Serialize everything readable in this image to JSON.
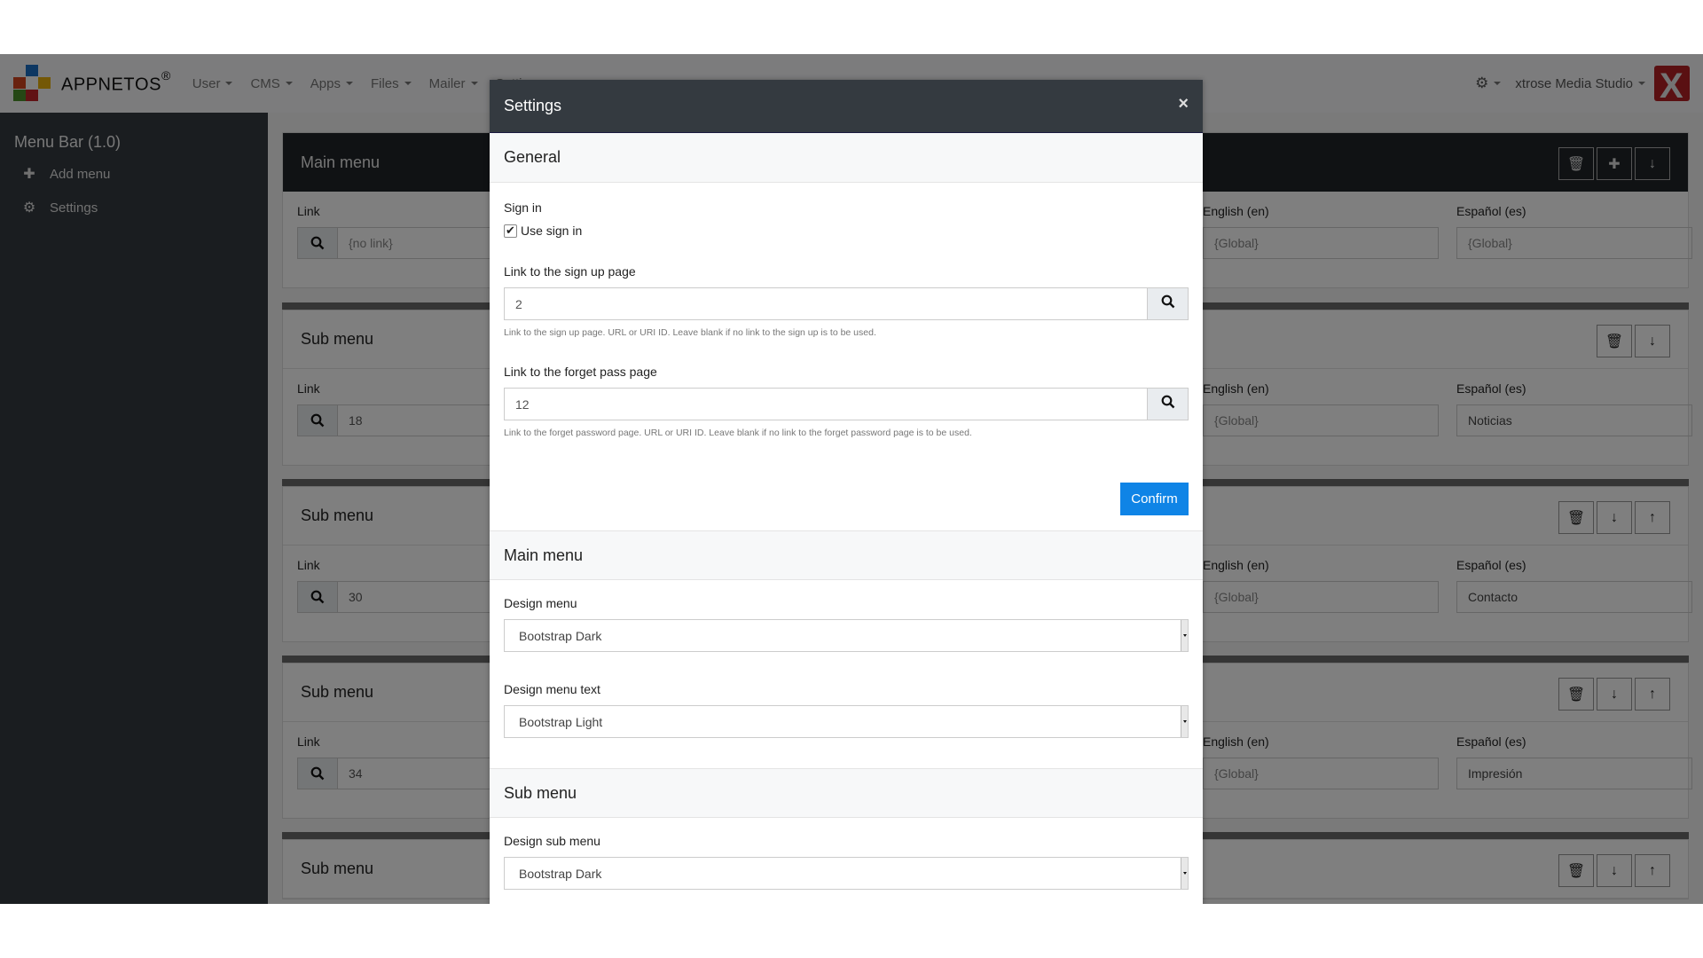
{
  "navbar": {
    "brand": "APPNET",
    "brand_suffix": "OS",
    "brand_mark": "®",
    "menu": [
      {
        "label": "User"
      },
      {
        "label": "CMS"
      },
      {
        "label": "Apps"
      },
      {
        "label": "Files"
      },
      {
        "label": "Mailer"
      },
      {
        "label": "Settings"
      }
    ],
    "gear_icon": "gear-icon",
    "user_name": "xtrose Media Studio",
    "user_badge": "X"
  },
  "sidebar": {
    "title": "Menu Bar (1.0)",
    "items": [
      {
        "label": "Add menu",
        "icon": "+"
      },
      {
        "label": "Settings",
        "icon": "⚙"
      }
    ]
  },
  "background": {
    "link_label": "Link",
    "lang_en": "English (en)",
    "lang_es": "Español (es)",
    "panels": [
      {
        "title": "Main menu",
        "link": "{no link}",
        "en": "{Global}",
        "es": "{Global}"
      },
      {
        "title": "Sub menu",
        "link": "18",
        "en": "{Global}",
        "es": "Noticias"
      },
      {
        "title": "Sub menu",
        "link": "30",
        "en": "{Global}",
        "es": "Contacto"
      },
      {
        "title": "Sub menu",
        "link": "34",
        "en": "{Global}",
        "es": "Impresión"
      },
      {
        "title": "Sub menu"
      }
    ]
  },
  "modal": {
    "title": "Settings",
    "close": "×",
    "general": {
      "heading": "General",
      "sign_in_label": "Sign in",
      "use_sign_in_label": "Use sign in",
      "use_sign_in_checked": true,
      "signup_label": "Link to the sign up page",
      "signup_value": "2",
      "signup_help": "Link to the sign up page. URL or URI ID. Leave blank if no link to the sign up is to be used.",
      "forget_label": "Link to the forget pass page",
      "forget_value": "12",
      "forget_help": "Link to the forget password page. URL or URI ID. Leave blank if no link to the forget password page is to be used.",
      "confirm": "Confirm"
    },
    "main_menu": {
      "heading": "Main menu",
      "design_label": "Design menu",
      "design_value": "Bootstrap Dark",
      "design_text_label": "Design menu text",
      "design_text_value": "Bootstrap Light"
    },
    "sub_menu": {
      "heading": "Sub menu",
      "design_label": "Design sub menu",
      "design_value": "Bootstrap Dark"
    }
  },
  "colors": {
    "primary": "#0f84e6",
    "modal_header": "#343a40",
    "sidebar": "#343a40",
    "user_badge": "#b52025"
  }
}
